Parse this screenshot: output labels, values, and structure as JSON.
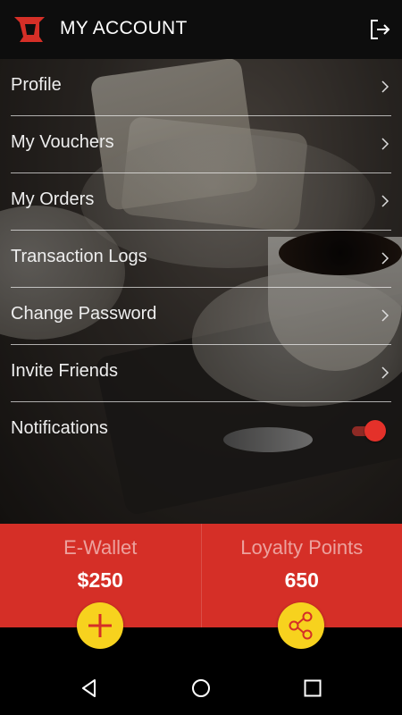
{
  "header": {
    "title": "MY ACCOUNT",
    "logo_icon": "brand-logo-icon",
    "logout_icon": "logout-icon"
  },
  "menu": {
    "items": [
      {
        "label": "Profile"
      },
      {
        "label": "My Vouchers"
      },
      {
        "label": "My Orders"
      },
      {
        "label": "Transaction Logs"
      },
      {
        "label": "Change Password"
      },
      {
        "label": "Invite Friends"
      }
    ],
    "notifications": {
      "label": "Notifications",
      "enabled": true
    }
  },
  "wallet": {
    "label": "E-Wallet",
    "value": "$250",
    "action_icon": "plus-icon"
  },
  "loyalty": {
    "label": "Loyalty Points",
    "value": "650",
    "action_icon": "share-icon"
  },
  "system_nav": {
    "back_icon": "back-icon",
    "home_icon": "home-icon",
    "recents_icon": "recents-icon"
  },
  "colors": {
    "accent_red": "#d52f27",
    "fab_yellow": "#f7d21e",
    "header_bg": "#0d0d0d"
  }
}
